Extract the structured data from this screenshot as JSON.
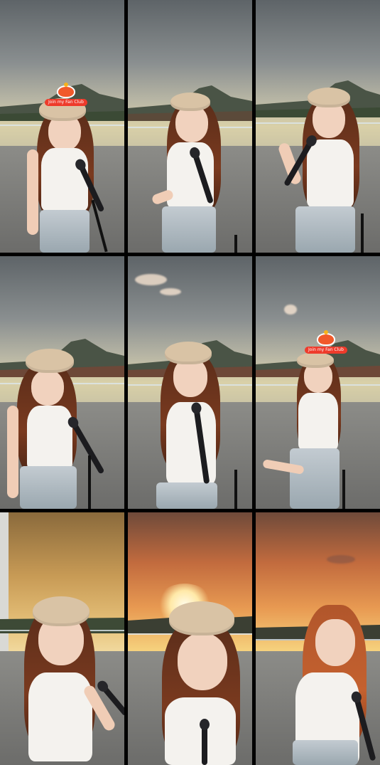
{
  "collage": {
    "rows": 3,
    "cols": 3,
    "frames": [
      {
        "id": "frame-1",
        "sky": "day",
        "badge": true
      },
      {
        "id": "frame-2",
        "sky": "day",
        "badge": false
      },
      {
        "id": "frame-3",
        "sky": "day",
        "badge": false
      },
      {
        "id": "frame-4",
        "sky": "day",
        "badge": false
      },
      {
        "id": "frame-5",
        "sky": "day",
        "badge": false
      },
      {
        "id": "frame-6",
        "sky": "day",
        "badge": true
      },
      {
        "id": "frame-7",
        "sky": "gold",
        "badge": false
      },
      {
        "id": "frame-8",
        "sky": "sunset",
        "badge": false
      },
      {
        "id": "frame-9",
        "sky": "sunset",
        "badge": false
      }
    ]
  },
  "badge": {
    "label": "Join my Fan Club",
    "icon": "fan-club-mascot-icon"
  },
  "colors": {
    "divider": "#000000",
    "badge_red": "#ee3b2b"
  }
}
